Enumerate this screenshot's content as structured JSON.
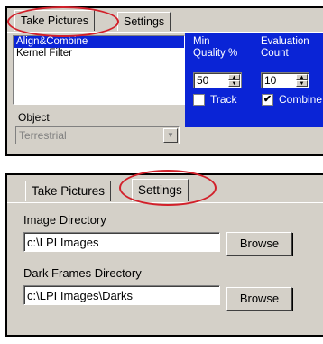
{
  "top_panel": {
    "tabs": [
      {
        "label": "Take Pictures"
      },
      {
        "label": "Settings"
      }
    ],
    "list": [
      "Align&Combine",
      "Kernel Filter"
    ],
    "min_quality_label_1": "Min",
    "min_quality_label_2": "Quality %",
    "eval_count_label_1": "Evaluation",
    "eval_count_label_2": "Count",
    "min_quality_value": "50",
    "eval_count_value": "10",
    "track_label": "Track",
    "combine_label": "Combine",
    "track_checked": false,
    "combine_checked": true,
    "object_label": "Object",
    "object_value": "Terrestrial"
  },
  "bottom_panel": {
    "tabs": [
      {
        "label": "Take Pictures"
      },
      {
        "label": "Settings"
      }
    ],
    "image_dir_label": "Image Directory",
    "image_dir_value": "c:\\LPI Images",
    "dark_dir_label": "Dark Frames Directory",
    "dark_dir_value": "c:\\LPI Images\\Darks",
    "browse_label": "Browse"
  },
  "colors": {
    "selection": "#0a24d6",
    "highlight_ring": "#d2202a",
    "panel": "#d4d0c8"
  }
}
